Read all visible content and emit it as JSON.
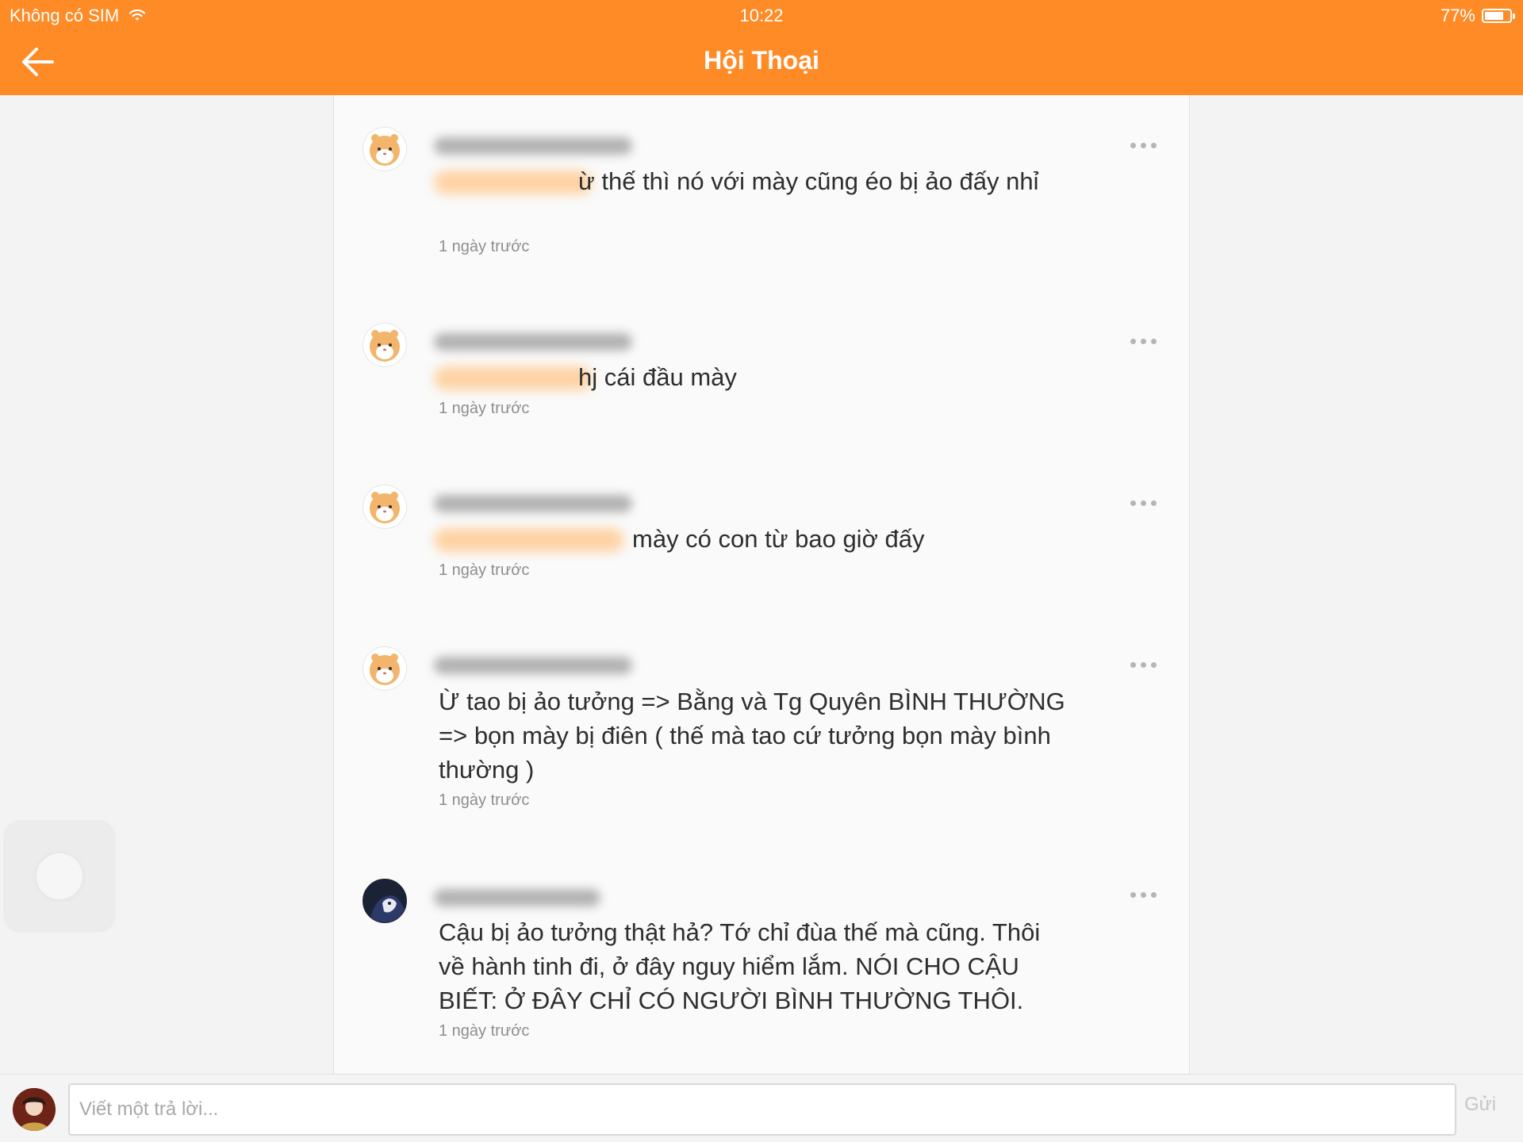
{
  "status_bar": {
    "carrier": "Không có SIM",
    "time": "10:22",
    "battery": "77%",
    "battery_level": 0.77
  },
  "header": {
    "title": "Hội Thoại"
  },
  "comments": [
    {
      "message": "ừ thế thì nó với mày cũng éo bị ảo đấy nhỉ",
      "time": "1 ngày trước"
    },
    {
      "message": "hj cái đầu mày",
      "time": "1 ngày trước"
    },
    {
      "message": "mày có con từ bao giờ đấy",
      "time": "1 ngày trước"
    },
    {
      "message": "Ừ tao bị ảo tưởng => Bằng và Tg Quyên BÌNH THƯỜNG => bọn mày bị điên ( thế mà tao cứ tưởng bọn mày bình thường )",
      "time": "1 ngày trước"
    },
    {
      "message": "Cậu bị ảo tưởng thật hả? Tớ chỉ đùa thế mà cũng. Thôi về hành tinh đi, ở đây nguy hiểm lắm. NÓI CHO CẬU BIẾT: Ở ĐÂY CHỈ CÓ NGƯỜI BÌNH THƯỜNG THÔI.",
      "time": "1 ngày trước"
    }
  ],
  "reply": {
    "placeholder": "Viết một trả lời...",
    "send_label": "Gửi"
  },
  "colors": {
    "header": "#ff8b26",
    "mention_highlight": "#ffc98f"
  }
}
